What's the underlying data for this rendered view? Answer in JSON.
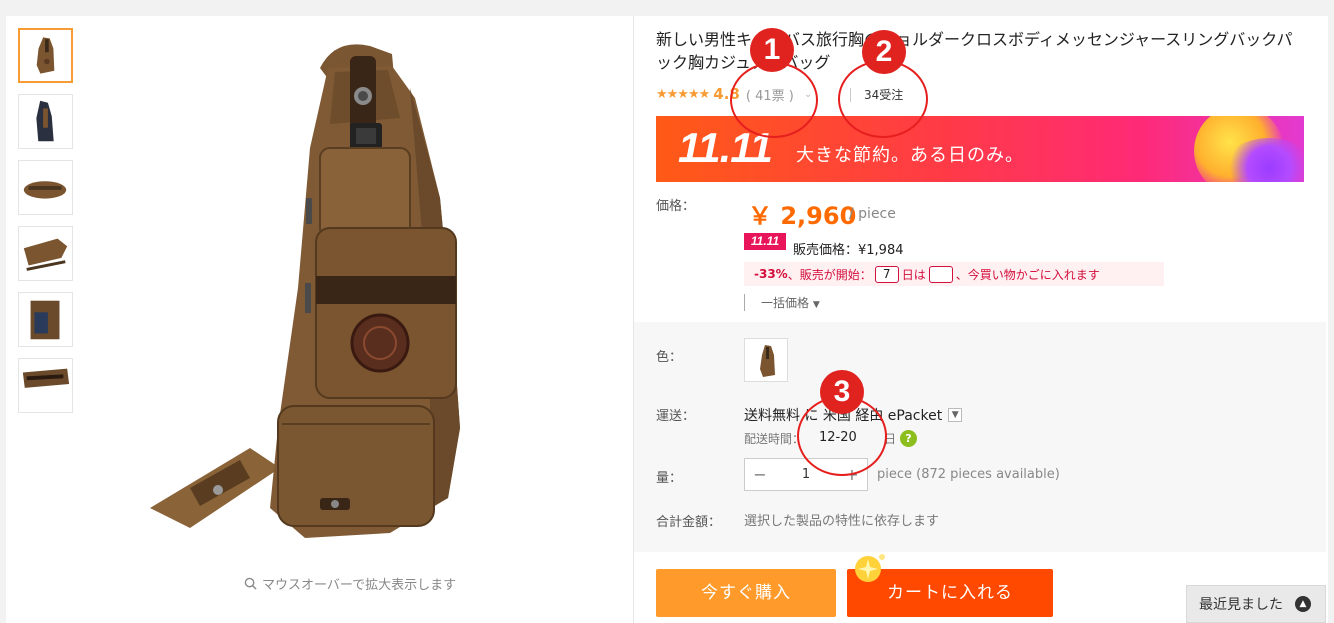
{
  "product": {
    "title": "新しい男性キャンバス旅行胸のショルダークロスボディメッセンジャースリングバックパック胸カジュアルバッグ",
    "rating": "4.8",
    "votes": "( 41票 )",
    "orders": "34受注"
  },
  "gallery": {
    "zoom_hint": "マウスオーバーで拡大表示します",
    "thumbnail_count": 6
  },
  "banner": {
    "event": "11.11",
    "tagline": "大きな節約。ある日のみ。"
  },
  "price": {
    "label": "価格：",
    "current": "￥ 2,960",
    "unit": "/ piece",
    "sale_badge": "11.11",
    "sale_price": "販売価格：¥1,984",
    "promo_percent": "-33%",
    "promo_middle": "、販売が開始：",
    "promo_days": "7",
    "promo_days_unit": "日は",
    "promo_end": "、今買い物かごに入れます",
    "bulk": "一括価格"
  },
  "options": {
    "color_label": "色：",
    "shipping_label": "運送：",
    "shipping_text": "送料無料 に 米国 経由 ePacket",
    "delivery_label": "配送時間：",
    "delivery_days": "12-20",
    "delivery_unit": "日",
    "qty_label": "量：",
    "qty_minus": "−",
    "qty_value": "1",
    "qty_plus": "+",
    "qty_available": "piece (872 pieces available)",
    "total_label": "合計金額：",
    "total_note": "選択した製品の特性に依存します"
  },
  "actions": {
    "buy_now": "今すぐ購入",
    "add_to_cart": "カートに入れる"
  },
  "recently_viewed": "最近見ました",
  "annotations": [
    "1",
    "2",
    "3"
  ],
  "colors": {
    "accent_orange": "#ff9a2b",
    "cart_red": "#ff4800",
    "price_orange": "#ff6a00",
    "annotation_red": "#e0231f"
  }
}
